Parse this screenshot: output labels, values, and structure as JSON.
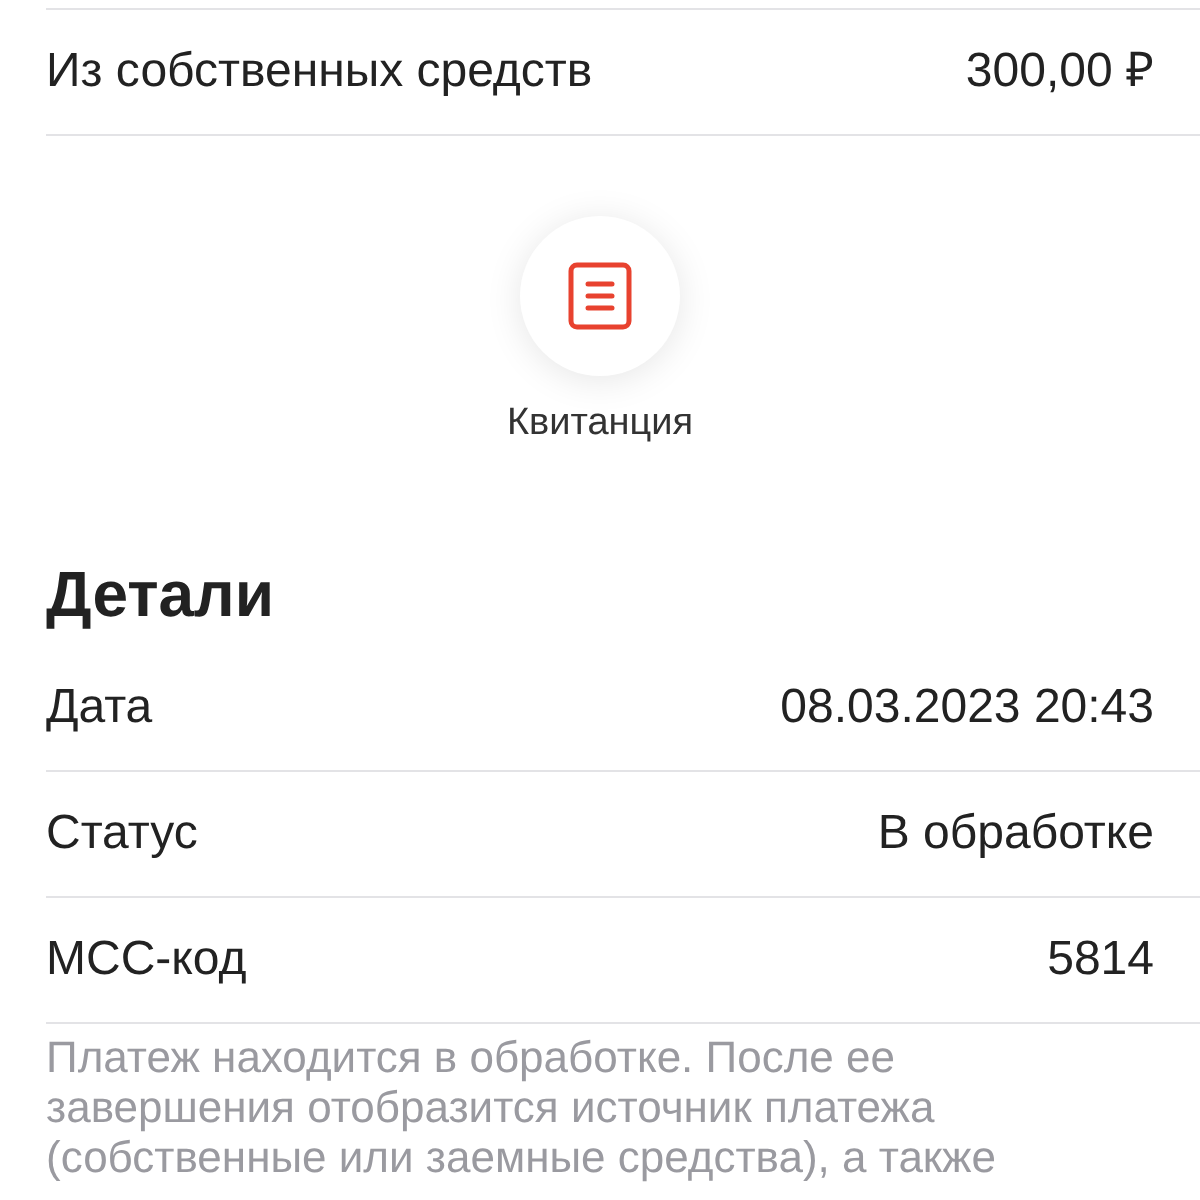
{
  "source_rows": [
    {
      "label": "Из собственных средств",
      "value": "300,00 ₽"
    }
  ],
  "receipt_action": {
    "label": "Квитанция"
  },
  "details": {
    "title": "Детали",
    "rows": [
      {
        "label": "Дата",
        "value": "08.03.2023 20:43"
      },
      {
        "label": "Статус",
        "value": "В обработке"
      },
      {
        "label": "MCC-код",
        "value": "5814"
      }
    ]
  },
  "note": "Платеж находится в обработке. После ее завершения отобразится источник платежа (собственные или заемные средства), а также"
}
